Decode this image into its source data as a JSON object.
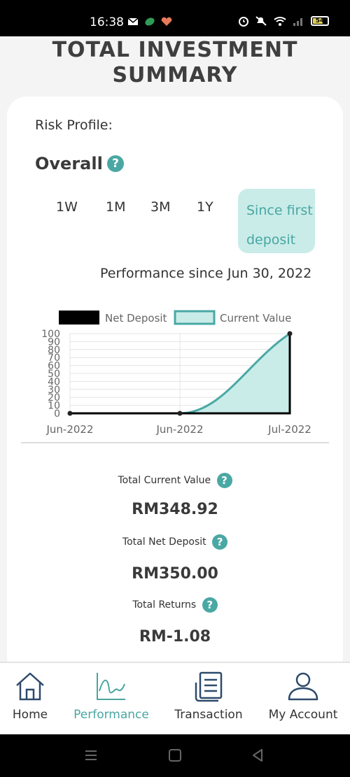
{
  "status_bar": {
    "time": "16:38",
    "battery": "54",
    "icons": [
      "mail-icon",
      "leaf-icon",
      "heart-icon",
      "alarm-icon",
      "mute-icon",
      "wifi-icon",
      "signal-icon",
      "battery-icon"
    ]
  },
  "page": {
    "title_line1": "TOTAL INVESTMENT",
    "title_line2": "SUMMARY"
  },
  "risk_profile": {
    "label": "Risk Profile:",
    "value": "Overall"
  },
  "periods": {
    "items": [
      "1W",
      "1M",
      "3M",
      "1Y"
    ],
    "active_line1": "Since first",
    "active_line2": "deposit"
  },
  "performance_since": "Performance since Jun 30, 2022",
  "chart_data": {
    "type": "area",
    "x": [
      "Jun-2022",
      "Jun-2022",
      "Jul-2022"
    ],
    "series": [
      {
        "name": "Net Deposit",
        "values": [
          0,
          0,
          100
        ],
        "color": "#000000"
      },
      {
        "name": "Current Value",
        "values": [
          0,
          0,
          100
        ],
        "color": "#4aa8a4"
      }
    ],
    "ylim": [
      0,
      100
    ],
    "yticks": [
      "100",
      "90",
      "80",
      "70",
      "60",
      "50",
      "40",
      "30",
      "20",
      "10",
      "0"
    ],
    "xticks": [
      "Jun-2022",
      "Jun-2022",
      "Jul-2022"
    ],
    "legend": "top",
    "grid": true
  },
  "stats": {
    "current_value_label": "Total Current Value",
    "current_value": "RM348.92",
    "net_deposit_label": "Total Net Deposit",
    "net_deposit": "RM350.00",
    "returns_label": "Total Returns",
    "returns": "RM-1.08"
  },
  "nav": {
    "home": "Home",
    "performance": "Performance",
    "transaction": "Transaction",
    "account": "My Account",
    "active": "performance"
  },
  "colors": {
    "accent": "#4aa8a4",
    "accent_light": "#c9ece9"
  }
}
